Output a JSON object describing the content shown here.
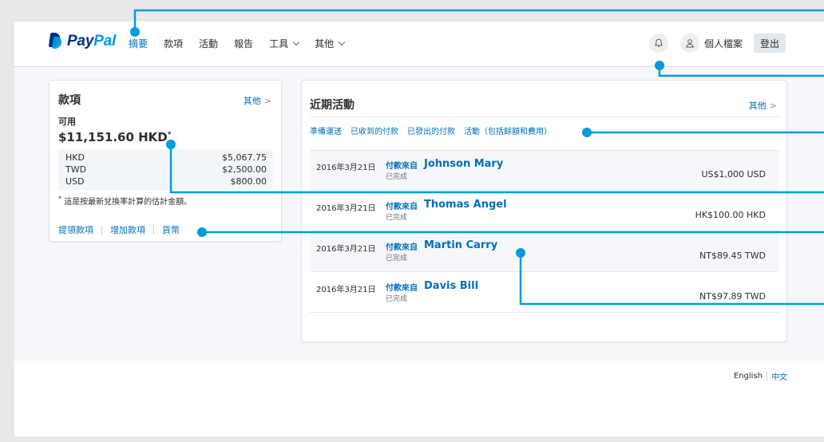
{
  "brand": {
    "logo_pay": "Pay",
    "logo_pal": "Pal",
    "color_dark": "#003087",
    "color_light": "#009cde"
  },
  "nav": {
    "items": [
      {
        "label": "摘要",
        "active": true
      },
      {
        "label": "款項",
        "active": false
      },
      {
        "label": "活動",
        "active": false
      },
      {
        "label": "報告",
        "active": false
      },
      {
        "label": "工具",
        "active": false,
        "dropdown": true
      },
      {
        "label": "其他",
        "active": false,
        "dropdown": true
      }
    ],
    "notification_icon": "bell-icon",
    "profile_label": "個人檔案",
    "profile_icon": "user-icon",
    "logout_label": "登出"
  },
  "balance": {
    "title": "款項",
    "more_label": "其他",
    "available_label": "可用",
    "available_amount": "$11,151.60 HKD",
    "asterisk": "*",
    "currencies": [
      {
        "code": "HKD",
        "amount": "$5,067.75"
      },
      {
        "code": "TWD",
        "amount": "$2,500.00"
      },
      {
        "code": "USD",
        "amount": "$800.00"
      }
    ],
    "note": "這是按最新兌換率計算的估計金額。",
    "links": [
      "提領款項",
      "增加款項",
      "貨幣"
    ]
  },
  "activity": {
    "title": "近期活動",
    "more_label": "其他",
    "filters": [
      "準備運送",
      "已收到的付款",
      "已發出的付款",
      "活動（包括餘額和費用）"
    ],
    "transactions": [
      {
        "date": "2016年3月21日",
        "type": "付款來自",
        "name": "Johnson Mary",
        "status": "已完成",
        "amount": "US$1,000 USD"
      },
      {
        "date": "2016年3月21日",
        "type": "付款來自",
        "name": "Thomas Angel",
        "status": "已完成",
        "amount": "HK$100.00 HKD"
      },
      {
        "date": "2016年3月21日",
        "type": "付款來自",
        "name": "Martin Carry",
        "status": "已完成",
        "amount": "NT$89.45 TWD"
      },
      {
        "date": "2016年3月21日",
        "type": "付款來自",
        "name": "Davis Bill",
        "status": "已完成",
        "amount": "NT$97.89 TWD"
      }
    ]
  },
  "footer": {
    "lang_en": "English",
    "lang_zh": "中文"
  },
  "colors": {
    "accent": "#0070ba",
    "callout": "#009cde"
  }
}
